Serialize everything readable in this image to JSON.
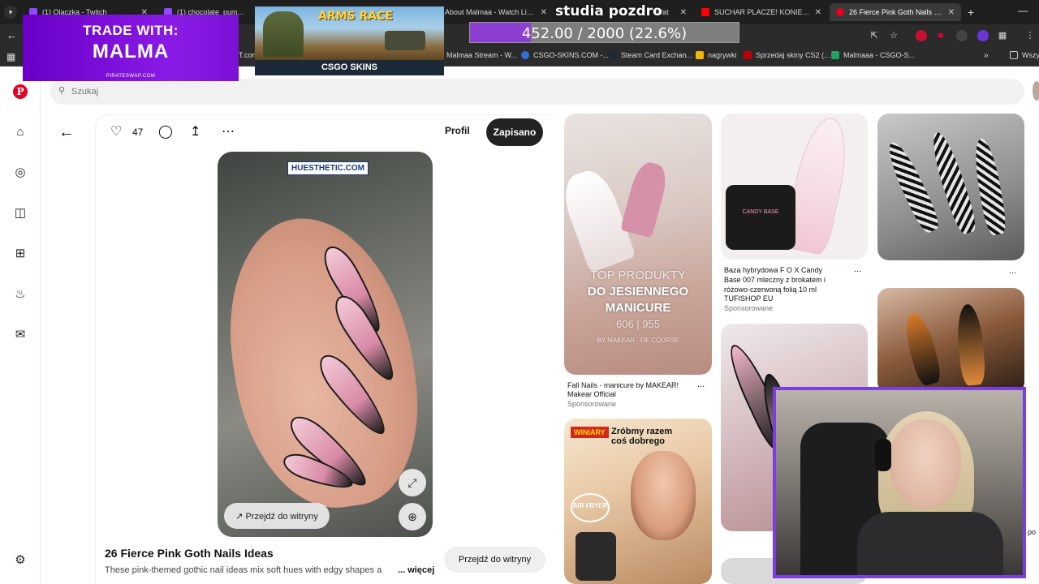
{
  "browser": {
    "tabs": [
      {
        "label": "(1) Olaczka - Twitch",
        "color": "#9146ff",
        "active": false
      },
      {
        "label": "(1) chocolate_puma - Twitch",
        "color": "#9146ff",
        "active": false
      },
      {
        "label": "About Malmaa - Watch Live on",
        "color": "#9146ff",
        "active": false
      },
      {
        "label": "Wat",
        "color": "#9146ff",
        "active": false
      },
      {
        "label": "SUCHAR PLACZE! KONIEC ZWI",
        "color": "#ff0000",
        "active": false
      },
      {
        "label": "26 Fierce Pink Goth Nails Ideas",
        "color": "#e60023",
        "active": true
      }
    ],
    "bookmarks": [
      {
        "label": "T.com",
        "color": "#555555"
      },
      {
        "label": "Malmaa Stream - W...",
        "color": "#555555"
      },
      {
        "label": "CSGO-SKINS.COM -...",
        "color": "#2f6fd6"
      },
      {
        "label": "Steam Card Exchan...",
        "color": "#1b2838"
      },
      {
        "label": "nagrywki",
        "color": "#f4b400"
      },
      {
        "label": "Sprzedaj skiny CS2 (...",
        "color": "#c00000"
      },
      {
        "label": "Malmaaa - CSGO-S...",
        "color": "#1ea362"
      },
      {
        "label": "Wszy",
        "color": "#555555"
      }
    ]
  },
  "overlay": {
    "trade_line1": "TRADE WITH:",
    "trade_line2": "MALMA",
    "trade_site": "PIRATESWAP.COM",
    "arms_race": "ARMS RACE",
    "csgo_skins": "CSGO SKINS",
    "studia": "studia pozdro",
    "progress_text": "452.00 / 2000 (22.6%)",
    "progress_fraction": 0.226,
    "progress_color": "#8d3fd1"
  },
  "pinterest": {
    "search_placeholder": "Szukaj",
    "likes": "47",
    "profile_label": "Profil",
    "saved_label": "Zapisano",
    "watermark": "HUESTHETIC.COM",
    "visit_label": "Przejdź do witryny",
    "title": "26 Fierce Pink Goth Nails Ideas",
    "description": "These pink-themed gothic nail ideas mix soft hues with edgy shapes a",
    "more_label": "... więcej",
    "visit_button": "Przejdź do witryny",
    "brand_color": "#e60023"
  },
  "grid": {
    "manicure": {
      "overlay_lines": [
        "TOP PRODUKTY",
        "DO JESIENNEGO",
        "MANICURE",
        "606 | 955",
        "BY MAKEAR · OF COURSE"
      ],
      "title": "Fall Nails - manicure by MAKEAR!",
      "source": "Makear Official",
      "sponsored": "Sponsorowane"
    },
    "fox": {
      "jar_label": "CANDY BASE",
      "title_lines": [
        "Baza hybrydowa F O X Candy",
        "Base 007 mleczny z brokatem i",
        "różowo-czerwoną folią 10 ml"
      ],
      "source": "TUFISHOP EU",
      "sponsored": "Sponsorowane"
    },
    "winiary": {
      "brand": "WINIARY",
      "slogan_lines": [
        "Zróbmy razem",
        "coś dobrego"
      ],
      "badge": "AIR FRYER"
    },
    "more_dots": "..."
  },
  "edge_text": "po"
}
